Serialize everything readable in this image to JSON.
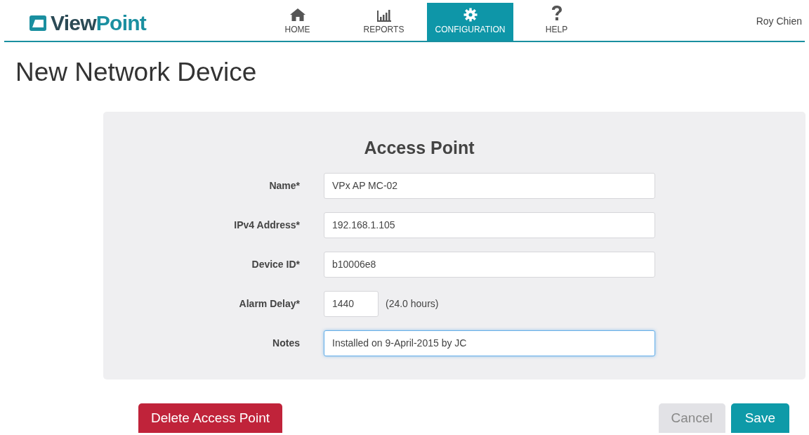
{
  "header": {
    "logo": [
      {
        "text": "View",
        "kind": "dark"
      },
      {
        "text": "Point",
        "kind": "accent"
      }
    ],
    "nav": [
      {
        "label": "HOME",
        "kind": "home",
        "selected": false
      },
      {
        "label": "REPORTS",
        "kind": "reports",
        "selected": false
      },
      {
        "label": "CONFIGURATION",
        "kind": "configuration",
        "selected": true
      },
      {
        "label": "HELP",
        "kind": "help",
        "selected": false
      }
    ],
    "user": "Roy Chien"
  },
  "page_title": "New Network Device",
  "form": {
    "heading": "Access Point",
    "fields": [
      {
        "label": "Name*",
        "value": "VPx AP MC-02",
        "kind": "wide",
        "focused": false
      },
      {
        "label": "IPv4 Address*",
        "value": "192.168.1.105",
        "kind": "wide",
        "focused": false
      },
      {
        "label": "Device ID*",
        "value": "b10006e8",
        "kind": "wide",
        "focused": false
      },
      {
        "label": "Alarm Delay*",
        "value": "1440",
        "kind": "short",
        "suffix": "(24.0 hours)",
        "focused": false
      },
      {
        "label": "Notes",
        "value": "Installed on 9-April-2015 by JC",
        "kind": "wide",
        "focused": true
      }
    ]
  },
  "buttons": [
    {
      "label": "Delete Access Point",
      "kind": "danger"
    },
    {
      "label": "Cancel",
      "kind": "secondary"
    },
    {
      "label": "Save",
      "kind": "primary"
    }
  ]
}
